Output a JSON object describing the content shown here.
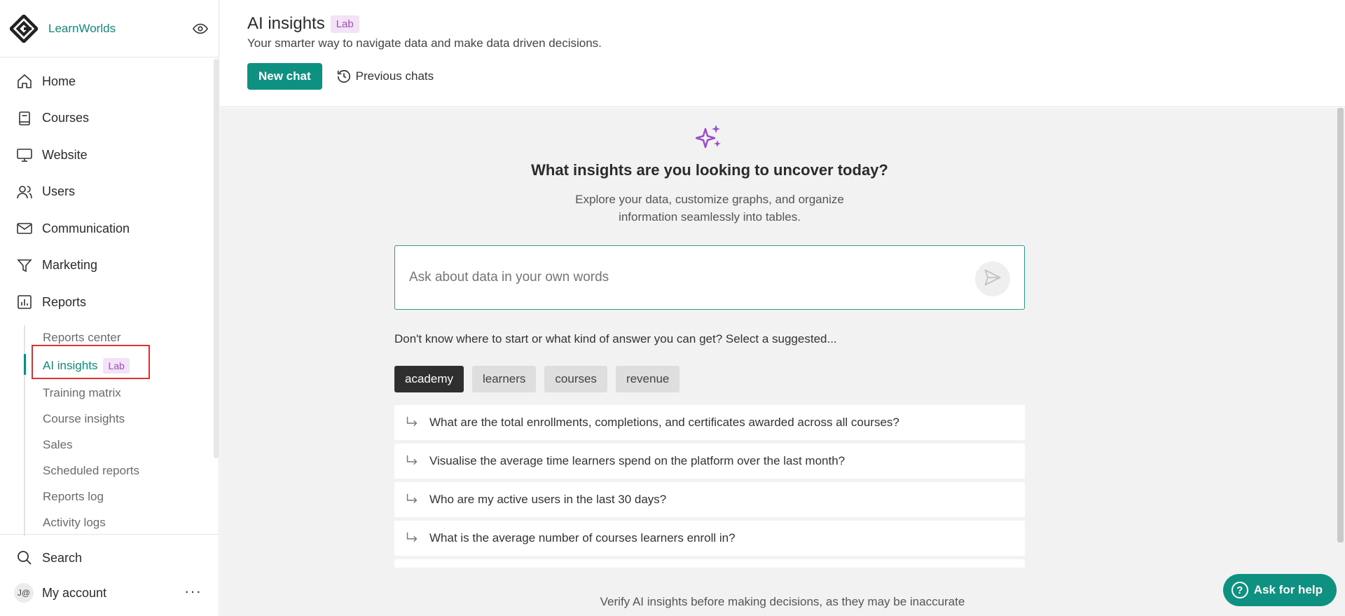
{
  "brand": {
    "name": "LearnWorlds",
    "logo_icon": "diamond-logo-icon",
    "visibility_icon": "eye-icon"
  },
  "sidebar": {
    "items": [
      {
        "label": "Home",
        "icon": "home-icon"
      },
      {
        "label": "Courses",
        "icon": "book-icon"
      },
      {
        "label": "Website",
        "icon": "monitor-icon"
      },
      {
        "label": "Users",
        "icon": "users-icon"
      },
      {
        "label": "Communication",
        "icon": "mail-icon"
      },
      {
        "label": "Marketing",
        "icon": "funnel-icon"
      },
      {
        "label": "Reports",
        "icon": "chart-icon"
      }
    ],
    "reports_sub": [
      {
        "label": "Reports center"
      },
      {
        "label": "AI insights",
        "badge": "Lab",
        "active": true
      },
      {
        "label": "Training matrix"
      },
      {
        "label": "Course insights"
      },
      {
        "label": "Sales"
      },
      {
        "label": "Scheduled reports"
      },
      {
        "label": "Reports log"
      },
      {
        "label": "Activity logs"
      }
    ],
    "bottom": {
      "search_label": "Search",
      "account_label": "My account",
      "avatar_initials": "J@",
      "more": "···"
    }
  },
  "header": {
    "title": "AI insights",
    "badge": "Lab",
    "subtitle": "Your smarter way to navigate data and make data driven decisions.",
    "new_chat": "New chat",
    "previous_chats": "Previous chats"
  },
  "main": {
    "headline": "What insights are you looking to uncover today?",
    "description": "Explore your data, customize graphs, and organize information seamlessly into tables.",
    "input_placeholder": "Ask about data in your own words",
    "hint": "Don't know where to start or what kind of answer you can get? Select a suggested...",
    "chips": [
      "academy",
      "learners",
      "courses",
      "revenue"
    ],
    "active_chip": "academy",
    "suggestions": [
      "What are the total enrollments, completions, and certificates awarded across all courses?",
      "Visualise the average time learners spend on the platform over the last month?",
      "Who are my active users in the last 30 days?",
      "What is the average number of courses learners enroll in?"
    ],
    "footer_note": "Verify AI insights before making decisions, as they may be inaccurate"
  },
  "help": {
    "label": "Ask for help"
  },
  "colors": {
    "accent": "#0e9180",
    "lab_bg": "#f2e3f7",
    "lab_text": "#a34cc0",
    "sparkle": "#9b4dca"
  }
}
